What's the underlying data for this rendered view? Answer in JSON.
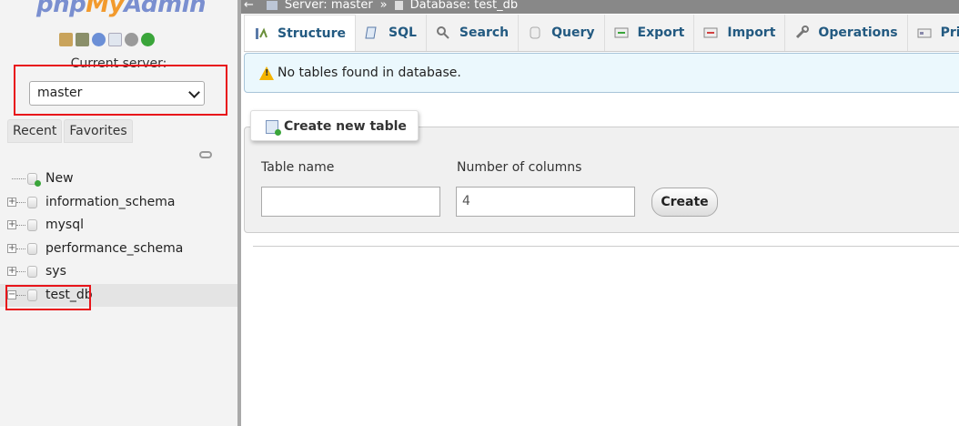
{
  "nav": {
    "logo_php": "php",
    "logo_my": "My",
    "logo_admin": "Admin",
    "icons": [
      "home-icon",
      "exit-icon",
      "help-icon",
      "docs-icon",
      "settings-icon",
      "reload-icon"
    ],
    "current_server_label": "Current server:",
    "server_selected": "master",
    "tabs": [
      {
        "label": "Recent"
      },
      {
        "label": "Favorites"
      }
    ],
    "tree": [
      {
        "label": "New",
        "kind": "new"
      },
      {
        "label": "information_schema",
        "kind": "db"
      },
      {
        "label": "mysql",
        "kind": "db"
      },
      {
        "label": "performance_schema",
        "kind": "db"
      },
      {
        "label": "sys",
        "kind": "db"
      },
      {
        "label": "test_db",
        "kind": "db",
        "selected": true
      }
    ]
  },
  "breadcrumb": {
    "back": "←",
    "server": "Server: master",
    "separator": "»",
    "database": "Database: test_db"
  },
  "tabs": [
    {
      "label": "Structure",
      "icon": "structure-icon",
      "active": true
    },
    {
      "label": "SQL",
      "icon": "sql-icon"
    },
    {
      "label": "Search",
      "icon": "search-icon"
    },
    {
      "label": "Query",
      "icon": "query-icon"
    },
    {
      "label": "Export",
      "icon": "export-icon"
    },
    {
      "label": "Import",
      "icon": "import-icon"
    },
    {
      "label": "Operations",
      "icon": "wrench-icon"
    },
    {
      "label": "Privi",
      "icon": "privileges-icon"
    }
  ],
  "notice": {
    "text": "No tables found in database."
  },
  "create_table": {
    "legend": "Create new table",
    "table_name_label": "Table name",
    "table_name_value": "",
    "columns_label": "Number of columns",
    "columns_value": "4",
    "create_label": "Create"
  },
  "colors": {
    "nav_bg": "#f3f3f3",
    "tab_text": "#235a81",
    "highlight_red": "#e8141a",
    "notice_bg": "#ebf8fd"
  }
}
